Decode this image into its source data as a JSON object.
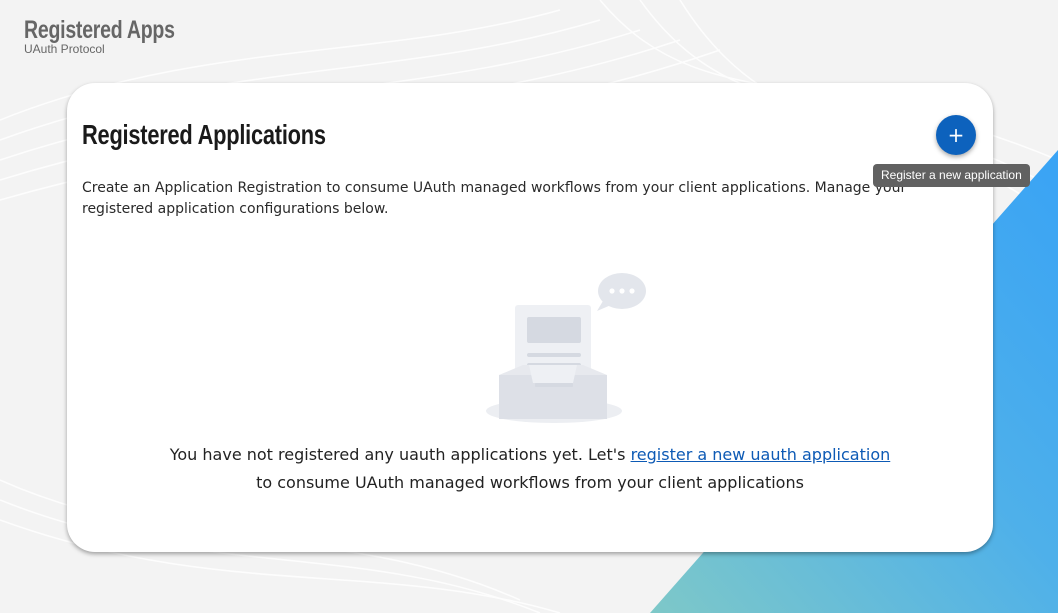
{
  "header": {
    "title": "Registered Apps",
    "subtitle": "UAuth Protocol"
  },
  "card": {
    "title": "Registered Applications",
    "description": "Create an Application Registration to consume UAuth managed workflows from your client applications. Manage your registered application configurations below.",
    "add_button_icon": "+",
    "add_button_tooltip": "Register a new application"
  },
  "empty_state": {
    "illustration_icon": "empty-inbox-icon",
    "message_prefix": "You have not registered any uauth applications yet. Let's ",
    "link_text": "register a new uauth application",
    "message_suffix": "to consume UAuth managed workflows from your client applications"
  },
  "colors": {
    "accent": "#0d62bd",
    "link": "#0d5ab5",
    "tooltip_bg": "#616161",
    "gradient_start": "#7ec8c8",
    "gradient_end": "#39a3f5"
  }
}
